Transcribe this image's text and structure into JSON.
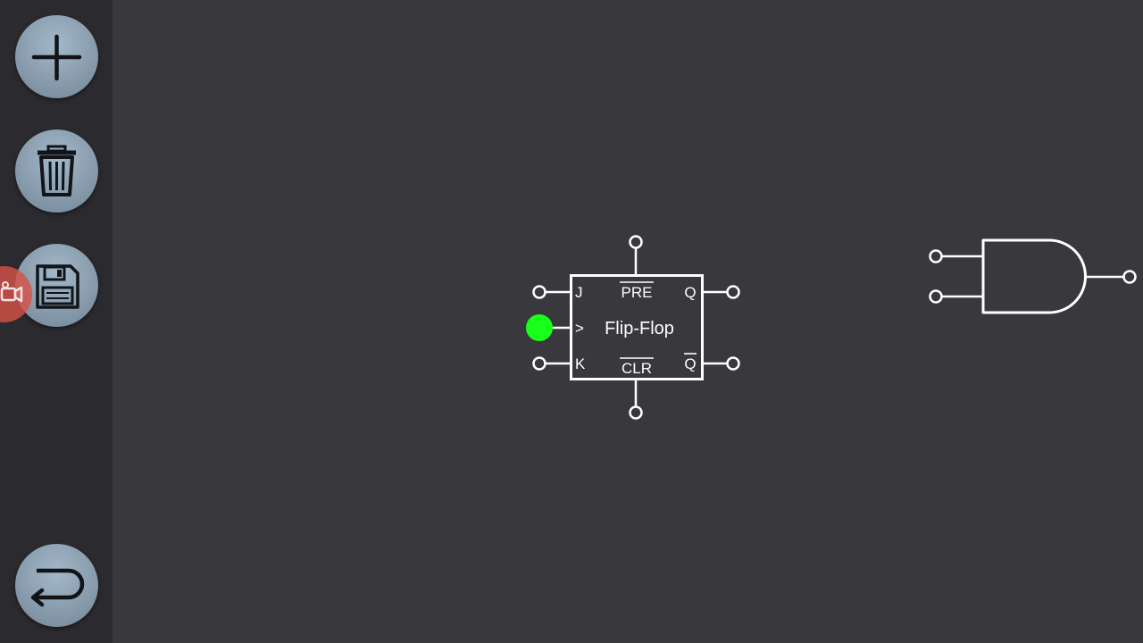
{
  "sidebar": {
    "buttons": [
      {
        "id": "add",
        "icon": "plus-icon"
      },
      {
        "id": "delete",
        "icon": "trash-icon"
      },
      {
        "id": "save",
        "icon": "floppy-disk-icon"
      },
      {
        "id": "undo",
        "icon": "undo-arrow-icon"
      }
    ]
  },
  "overlay": {
    "record_icon": "video-camera-icon",
    "color": "#d65248"
  },
  "components": {
    "flipflop": {
      "title": "Flip-Flop",
      "pins": {
        "j": "J",
        "clock": ">",
        "k": "K",
        "preset": "PRE",
        "clear": "CLR",
        "q": "Q",
        "q_bar": "Q"
      },
      "clock_state_color": "#1aff1a"
    },
    "and_gate": {
      "icon": "and-gate-icon"
    }
  },
  "colors": {
    "canvas": "#38383d",
    "sidebar": "#2b2b2f",
    "wire": "#ffffff"
  }
}
